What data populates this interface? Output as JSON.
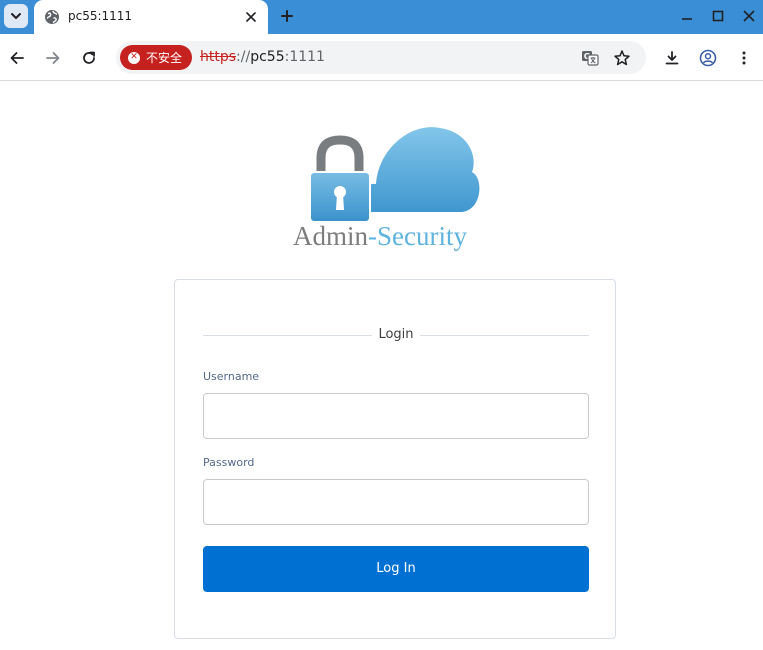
{
  "browser": {
    "tab": {
      "title": "pc55:1111"
    },
    "security_chip": {
      "label": "不安全"
    },
    "address": {
      "scheme": "https",
      "separator": "://",
      "host": "pc55",
      "port": ":1111"
    },
    "colors": {
      "tabstrip": "#3a8ed6",
      "insecure": "#c5221f"
    }
  },
  "logo": {
    "word_left": "Admin",
    "dash": "-",
    "word_right": "Security"
  },
  "login": {
    "legend": "Login",
    "username": {
      "label": "Username",
      "value": "",
      "placeholder": ""
    },
    "password": {
      "label": "Password",
      "value": "",
      "placeholder": ""
    },
    "submit_label": "Log In",
    "colors": {
      "button": "#0070d2",
      "label": "#54698d"
    }
  }
}
